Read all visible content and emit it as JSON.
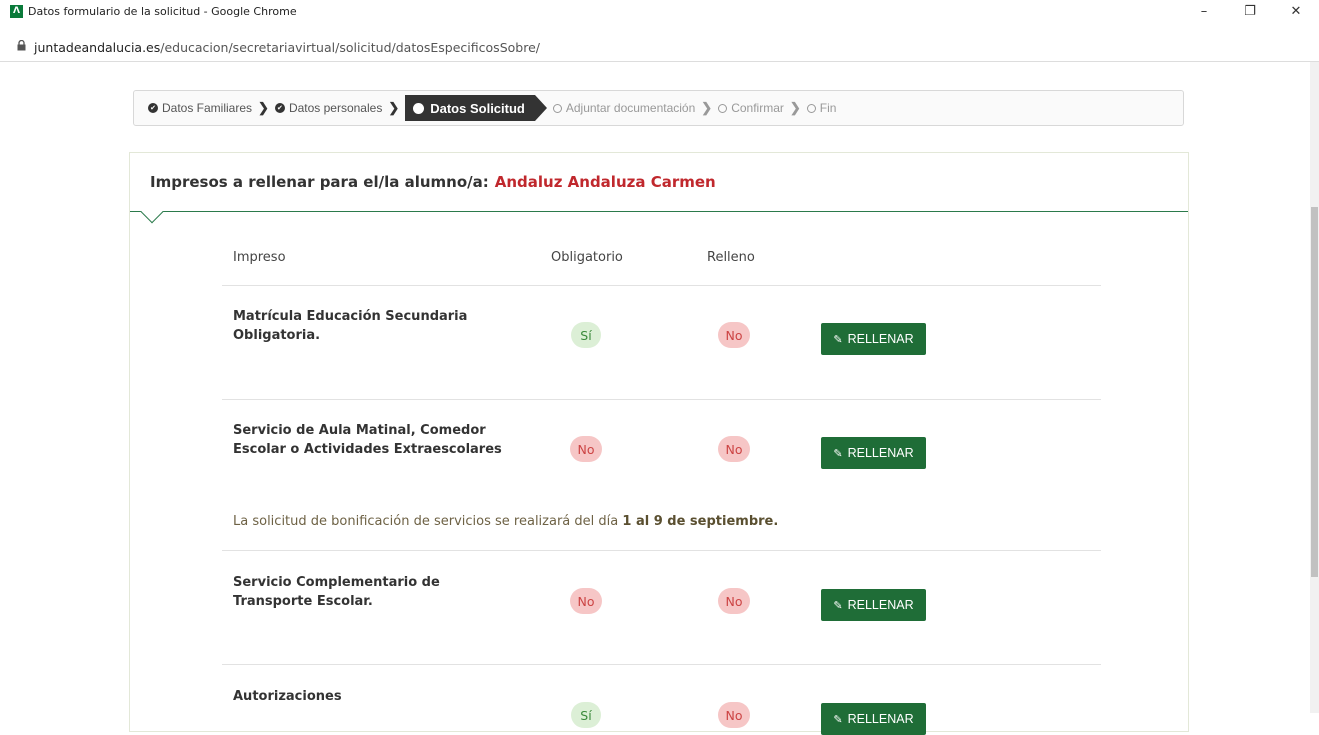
{
  "window": {
    "title": "Datos formulario de la solicitud - Google Chrome",
    "app_icon": "Λ",
    "controls": [
      "–",
      "❐",
      "✕"
    ]
  },
  "address": {
    "host": "juntadeandalucia.es",
    "path": "/educacion/secretariavirtual/solicitud/datosEspecificosSobre/"
  },
  "breadcrumb": {
    "steps": [
      {
        "label": "Datos Familiares",
        "state": "done"
      },
      {
        "label": "Datos personales",
        "state": "done"
      },
      {
        "label": "Datos Solicitud",
        "state": "active"
      },
      {
        "label": "Adjuntar documentación",
        "state": "pending"
      },
      {
        "label": "Confirmar",
        "state": "pending"
      },
      {
        "label": "Fin",
        "state": "pending"
      }
    ]
  },
  "card": {
    "heading": "Impresos a rellenar para el/la alumno/a:",
    "student": "Andaluz Andaluza Carmen"
  },
  "table": {
    "columns": {
      "impreso": "Impreso",
      "obligatorio": "Obligatorio",
      "relleno": "Relleno"
    },
    "button_label": "RELLENAR",
    "rows": [
      {
        "name_line1": "Matrícula Educación Secundaria",
        "name_line2": "Obligatoria.",
        "obligatorio": "Sí",
        "relleno": "No"
      },
      {
        "name_line1": "Servicio de Aula Matinal, Comedor",
        "name_line2": "Escolar o Actividades Extraescolares",
        "obligatorio": "No",
        "relleno": "No"
      },
      {
        "name_line1": "Servicio Complementario de",
        "name_line2": "Transporte Escolar.",
        "obligatorio": "No",
        "relleno": "No"
      },
      {
        "name_line1": "Autorizaciones",
        "name_line2": "",
        "obligatorio": "Sí",
        "relleno": "No"
      }
    ],
    "notice_prefix": "La solicitud de bonificación de servicios se realizará del día",
    "notice_bold": "1 al 9 de septiembre."
  },
  "colors": {
    "accent": "#1f6d37",
    "student": "#c0282d",
    "yes_bg": "#dcefd6",
    "no_bg": "#f6c6c6"
  }
}
